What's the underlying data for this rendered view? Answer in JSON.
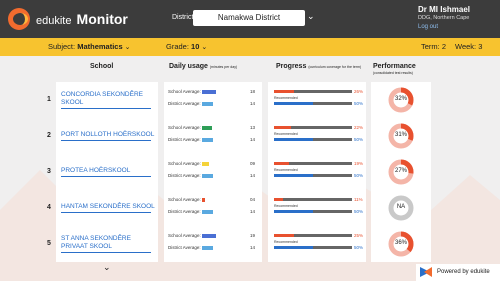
{
  "header": {
    "brand_prefix": "edukite",
    "brand_name": "Monitor",
    "district_label": "District",
    "district_value": "Namakwa District",
    "user_name": "Dr MI Ishmael",
    "user_role": "DDG, Northern Cape",
    "logout": "Log out"
  },
  "filters": {
    "subject_label": "Subject:",
    "subject_value": "Mathematics",
    "grade_label": "Grade:",
    "grade_value": "10",
    "term": "Term: 2",
    "week": "Week: 3"
  },
  "columns": {
    "school": "School",
    "usage": "Daily usage",
    "usage_note": "(minutes per day)",
    "progress": "Progress",
    "progress_note": "(curriculum coverage for the term)",
    "performance": "Performance",
    "performance_note": "(consolidated test results)"
  },
  "labels": {
    "school_avg": "School Average:",
    "district_avg": "District Average:",
    "recommended": "Recommended"
  },
  "rows": [
    {
      "num": "1",
      "name_l1": "CONCORDIA SEKONDÊRE",
      "name_l2": "SKOOL",
      "school_usage": "18",
      "district_usage": "14",
      "usage_color": "#4a6fd4",
      "school_progress": "26%",
      "progress_value": 26,
      "recommended": "50%",
      "performance": "32%",
      "performance_value": 32
    },
    {
      "num": "2",
      "name_l1": "PORT NOLLOTH HOËRSKOOL",
      "name_l2": "",
      "school_usage": "13",
      "district_usage": "14",
      "usage_color": "#2e9e57",
      "school_progress": "22%",
      "progress_value": 22,
      "recommended": "50%",
      "performance": "31%",
      "performance_value": 31
    },
    {
      "num": "3",
      "name_l1": "PROTEA HOËRSKOOL",
      "name_l2": "",
      "school_usage": "09",
      "district_usage": "14",
      "usage_color": "#f5d33a",
      "school_progress": "19%",
      "progress_value": 19,
      "recommended": "50%",
      "performance": "27%",
      "performance_value": 27
    },
    {
      "num": "4",
      "name_l1": "HANTAM SEKONDÊRE SKOOL",
      "name_l2": "",
      "school_usage": "04",
      "district_usage": "14",
      "usage_color": "#e8512f",
      "school_progress": "11%",
      "progress_value": 11,
      "recommended": "50%",
      "performance": "NA",
      "performance_value": null
    },
    {
      "num": "5",
      "name_l1": "ST ANNA SEKONDÊRE",
      "name_l2": "PRIVAAT SKOOL",
      "school_usage": "19",
      "district_usage": "14",
      "usage_color": "#4a6fd4",
      "school_progress": "25%",
      "progress_value": 25,
      "recommended": "50%",
      "performance": "36%",
      "performance_value": 36
    }
  ],
  "footer": {
    "powered_by": "Powered by edukite"
  },
  "colors": {
    "accent_yellow": "#f7c32f",
    "header_dark": "#3c3c3c",
    "progress_red": "#e8512f",
    "link_blue": "#2a6fc9",
    "district_bar": "#5aa9e0"
  }
}
